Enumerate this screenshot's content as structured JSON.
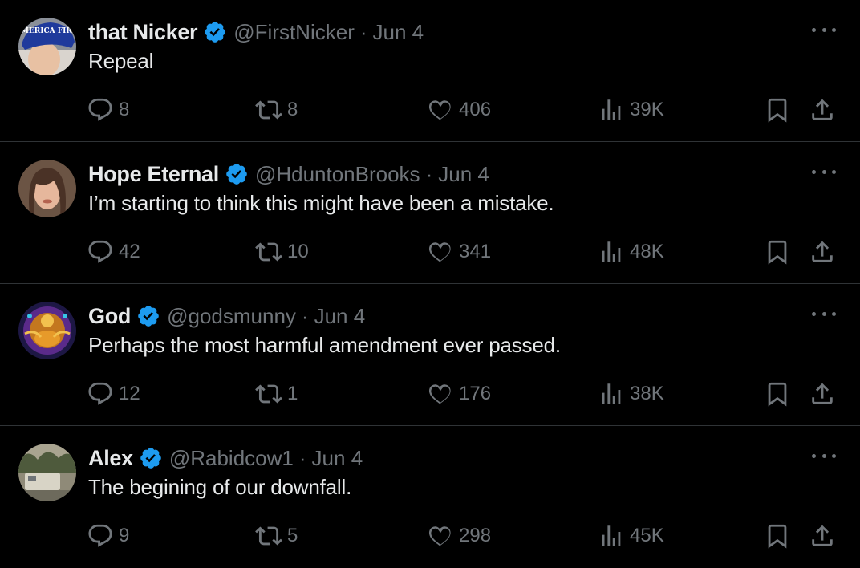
{
  "colors": {
    "background": "#000000",
    "text": "#e7e9ea",
    "muted": "#71767b",
    "verified": "#1d9bf0",
    "divider": "#2f3336"
  },
  "tweets": [
    {
      "name": "that Nicker",
      "handle": "@FirstNicker",
      "dot": "·",
      "date": "Jun 4",
      "text": "Repeal",
      "replies": "8",
      "reposts": "8",
      "likes": "406",
      "views": "39K",
      "avatar_caption": "AMERICA FIRST"
    },
    {
      "name": "Hope Eternal",
      "handle": "@HduntonBrooks",
      "dot": "·",
      "date": "Jun 4",
      "text": "I’m starting to think this might have been a mistake.",
      "replies": "42",
      "reposts": "10",
      "likes": "341",
      "views": "48K"
    },
    {
      "name": "God",
      "handle": "@godsmunny",
      "dot": "·",
      "date": "Jun 4",
      "text": "Perhaps the most harmful amendment ever passed.",
      "replies": "12",
      "reposts": "1",
      "likes": "176",
      "views": "38K"
    },
    {
      "name": "Alex",
      "handle": "@Rabidcow1",
      "dot": "·",
      "date": "Jun 4",
      "text": "The begining of our downfall.",
      "replies": "9",
      "reposts": "5",
      "likes": "298",
      "views": "45K"
    }
  ]
}
